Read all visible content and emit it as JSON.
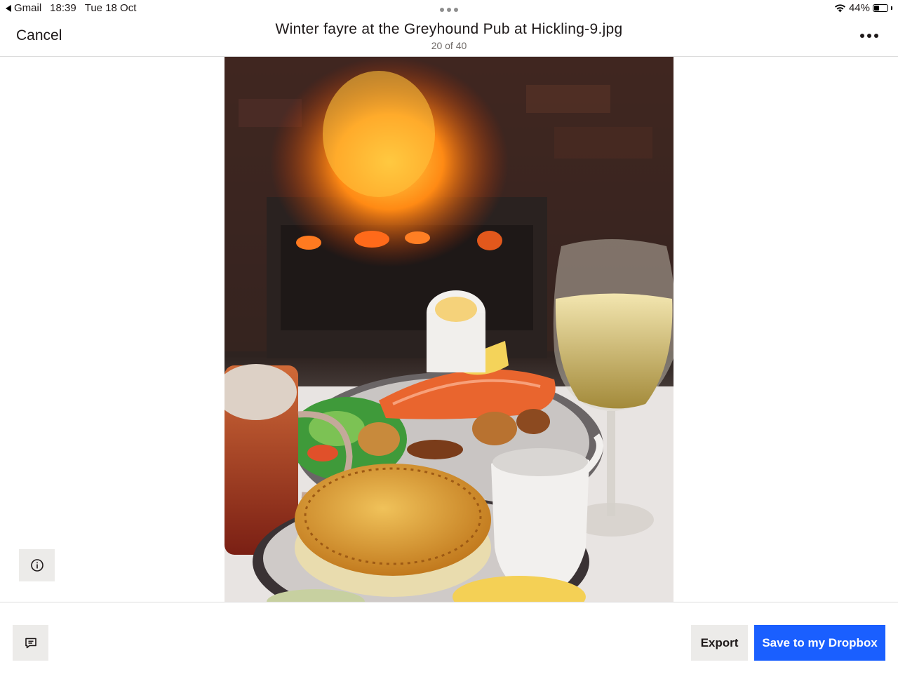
{
  "status_bar": {
    "back_app": "Gmail",
    "time": "18:39",
    "date": "Tue 18 Oct",
    "battery": "44%",
    "battery_level": 0.44,
    "icons": [
      "back-arrow-icon",
      "wifi-icon",
      "battery-icon"
    ]
  },
  "header": {
    "cancel_label": "Cancel",
    "file_name": "Winter fayre at the Greyhound Pub at Hickling-9.jpg",
    "position": "20 of 40",
    "more_icon": "more-options-icon"
  },
  "photo": {
    "subject": "photo-preview"
  },
  "sidebar": {
    "info_icon": "info-icon"
  },
  "footer": {
    "comment_icon": "comment-icon",
    "export_label": "Export",
    "save_label": "Save to my Dropbox"
  },
  "colors": {
    "accent": "#1a5fff",
    "secondary_button": "#ecebe9",
    "text": "#1e1919",
    "muted": "#6f6a67"
  }
}
